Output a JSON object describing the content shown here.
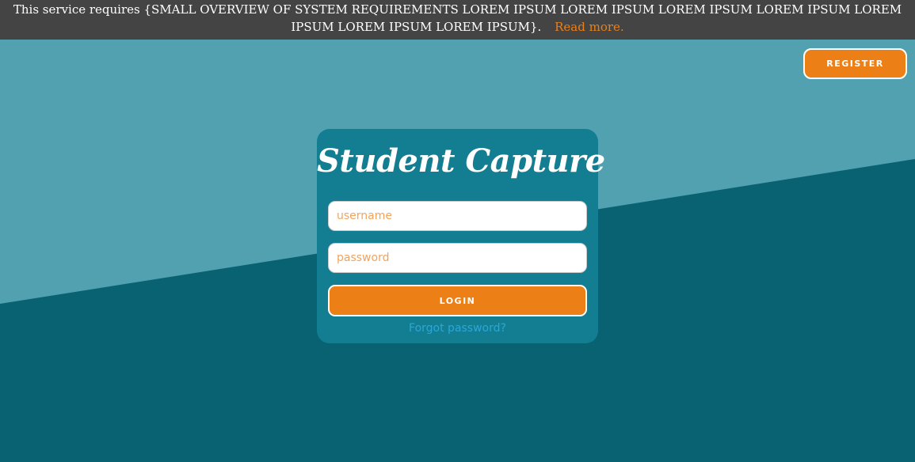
{
  "notice": {
    "text": "This service requires {SMALL OVERVIEW OF SYSTEM REQUIREMENTS LOREM IPSUM LOREM IPSUM LOREM IPSUM LOREM IPSUM LOREM IPSUM LOREM IPSUM LOREM IPSUM}.",
    "read_more": "Read more."
  },
  "header": {
    "register_label": "REGISTER"
  },
  "login": {
    "logo_text": "Student Capture",
    "username_placeholder": "username",
    "password_placeholder": "password",
    "username_value": "",
    "password_value": "",
    "submit_label": "LOGIN",
    "forgot_label": "Forgot password?"
  },
  "colors": {
    "background_light": "#52a1b0",
    "background_dark": "#096272",
    "notice_bar": "#444444",
    "card": "#137d92",
    "accent": "#ec7f16",
    "link": "#2aa7d8",
    "placeholder": "#f0a45e"
  }
}
